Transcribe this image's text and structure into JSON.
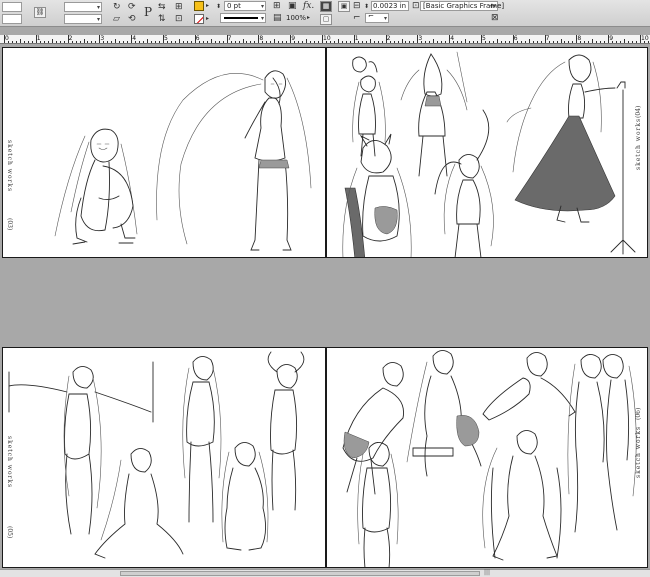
{
  "toolbar": {
    "stroke_weight": "0 pt",
    "zoom": "100%",
    "offset_value": "0.0023 in",
    "object_style": "[Basic Graphics Frame]",
    "object_style_suffix": "+",
    "fill_color": "#f6c019",
    "type_tool_glyph": "P"
  },
  "ruler": {
    "numbers": [
      "0",
      "1",
      "2",
      "3",
      "4",
      "5",
      "6",
      "7",
      "8",
      "9",
      "10",
      "1",
      "2",
      "3",
      "4",
      "5",
      "6",
      "7",
      "8",
      "9",
      "10"
    ]
  },
  "spreads": [
    {
      "left_label": "sketch works",
      "left_page_num": "(03)",
      "right_label": "sketch works",
      "right_page_num": "(04)"
    },
    {
      "left_label": "sketch works",
      "left_page_num": "(05)",
      "right_label": "sketch works",
      "right_page_num": "(06)"
    }
  ],
  "scrollbar": {
    "grip": "|||"
  }
}
